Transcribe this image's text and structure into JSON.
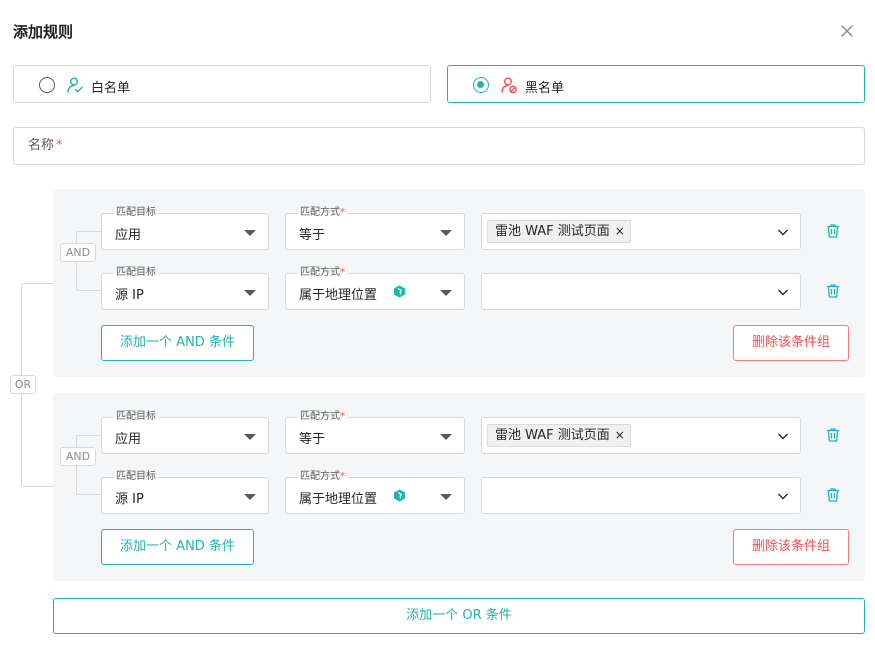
{
  "dialog": {
    "title": "添加规则",
    "close_icon": "close-icon"
  },
  "rule_type": {
    "options": [
      {
        "label": "白名单",
        "icon": "user-check-icon",
        "selected": false
      },
      {
        "label": "黑名单",
        "icon": "user-block-icon",
        "selected": true
      }
    ]
  },
  "name_field": {
    "label": "名称",
    "required_mark": "*",
    "value": ""
  },
  "or_label": "OR",
  "groups": [
    {
      "and_label": "AND",
      "conditions": [
        {
          "target_label": "匹配目标",
          "target_value": "应用",
          "method_label": "匹配方式",
          "method_required": "*",
          "method_value": "等于",
          "method_icon": "",
          "value_tags": [
            {
              "label": "雷池 WAF 测试页面",
              "remove": "×"
            }
          ]
        },
        {
          "target_label": "匹配目标",
          "target_value": "源 IP",
          "method_label": "匹配方式",
          "method_required": "*",
          "method_value": "属于地理位置",
          "method_icon": "geo-location-icon",
          "value_tags": []
        }
      ],
      "add_and_label": "添加一个 AND 条件",
      "delete_group_label": "删除该条件组"
    },
    {
      "and_label": "AND",
      "conditions": [
        {
          "target_label": "匹配目标",
          "target_value": "应用",
          "method_label": "匹配方式",
          "method_required": "*",
          "method_value": "等于",
          "method_icon": "",
          "value_tags": [
            {
              "label": "雷池 WAF 测试页面",
              "remove": "×"
            }
          ]
        },
        {
          "target_label": "匹配目标",
          "target_value": "源 IP",
          "method_label": "匹配方式",
          "method_required": "*",
          "method_value": "属于地理位置",
          "method_icon": "geo-location-icon",
          "value_tags": []
        }
      ],
      "add_and_label": "添加一个 AND 条件",
      "delete_group_label": "删除该条件组"
    }
  ],
  "add_or_label": "添加一个 OR 条件",
  "colors": {
    "accent": "#1fb5a8",
    "danger": "#ff4d4f",
    "border": "#d9d9d9",
    "group_bg": "#f5f6f7"
  }
}
